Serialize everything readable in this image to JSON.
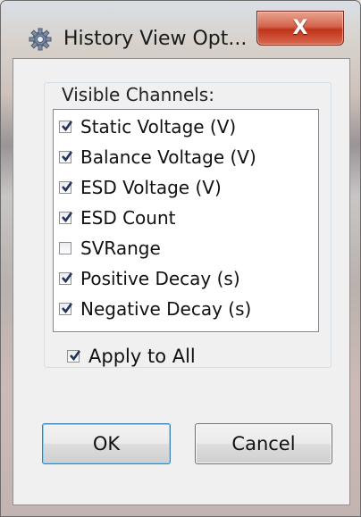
{
  "window": {
    "title": "History View Opt...",
    "close_label": "X",
    "icon": "gear-icon"
  },
  "group": {
    "label": "Visible Channels:"
  },
  "channels": [
    {
      "label": "Static Voltage (V)",
      "checked": true
    },
    {
      "label": "Balance Voltage (V)",
      "checked": true
    },
    {
      "label": "ESD Voltage (V)",
      "checked": true
    },
    {
      "label": "ESD Count",
      "checked": true
    },
    {
      "label": "SVRange",
      "checked": false
    },
    {
      "label": "Positive Decay (s)",
      "checked": true
    },
    {
      "label": "Negative Decay (s)",
      "checked": true
    }
  ],
  "apply_all": {
    "label": "Apply to All",
    "checked": true
  },
  "buttons": {
    "ok": "OK",
    "cancel": "Cancel"
  },
  "colors": {
    "close_button": "#c7432a",
    "default_button_border": "#3c7fb1",
    "checkmark": "#23325a"
  }
}
